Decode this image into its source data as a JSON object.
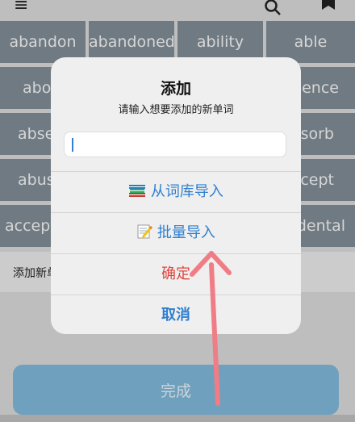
{
  "header": {
    "menu_icon": "menu-icon",
    "search_icon": "search-icon",
    "bookmark_icon": "bookmark-icon"
  },
  "words": {
    "r1": [
      "abandon",
      "abandoned",
      "ability",
      "able"
    ],
    "r2": [
      "abou",
      "sence"
    ],
    "r3": [
      "abse",
      "sorb"
    ],
    "r4": [
      "abus",
      "cept"
    ],
    "r5": [
      "accept",
      "dental"
    ]
  },
  "strip": {
    "label": "添加新单"
  },
  "dialog": {
    "title": "添加",
    "subtitle": "请输入想要添加的新单词",
    "input_value": "",
    "import_from_library": "从词库导入",
    "batch_import": "批量导入",
    "confirm": "确定",
    "cancel": "取消",
    "library_icon": "books-icon",
    "batch_icon": "memo-icon"
  },
  "footer": {
    "done": "完成"
  }
}
